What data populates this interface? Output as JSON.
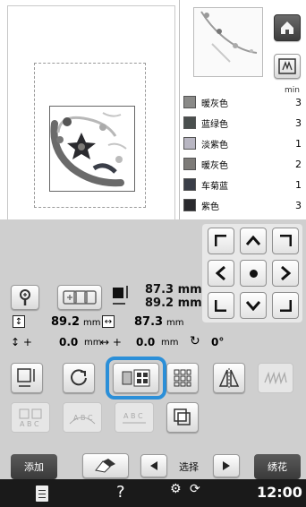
{
  "threads": {
    "header": "min",
    "items": [
      {
        "name": "暖灰色",
        "count": "3",
        "color": "#8a8a88"
      },
      {
        "name": "蓝绿色",
        "count": "3",
        "color": "#4a4f4e"
      },
      {
        "name": "淡紫色",
        "count": "1",
        "color": "#b8b6c2"
      },
      {
        "name": "暖灰色",
        "count": "2",
        "color": "#7d7b78"
      },
      {
        "name": "车菊蓝",
        "count": "1",
        "color": "#3a3e48"
      },
      {
        "name": "紫色",
        "count": "3",
        "color": "#2a2a2e"
      }
    ]
  },
  "size": {
    "width_top": "87.3 mm",
    "height_top": "89.2 mm",
    "width": "87.3",
    "width_unit": "mm",
    "height": "89.2",
    "height_unit": "mm",
    "offset_x": "0.0",
    "offset_x_unit": "mm",
    "offset_y": "0.0",
    "offset_y_unit": "mm",
    "rotation": "0°"
  },
  "bottom_buttons": {
    "add": "添加",
    "select": "选择",
    "embroider": "绣花"
  },
  "status": {
    "time": "12:00",
    "help": "?"
  },
  "colors": {
    "accent": "#2b8fd8",
    "panel": "#cfcfcf",
    "dark_button": "#444444"
  }
}
